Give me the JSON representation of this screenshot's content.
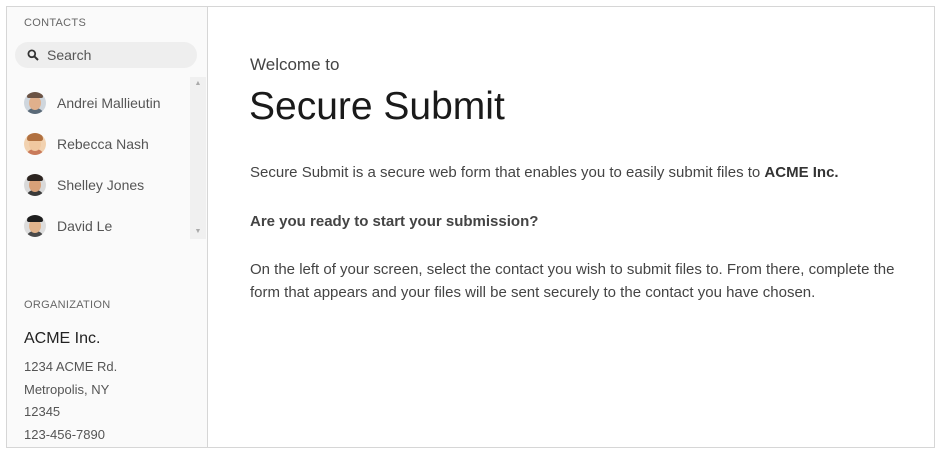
{
  "sidebar": {
    "contacts_title": "CONTACTS",
    "search_placeholder": "Search",
    "contacts": [
      {
        "name": "Andrei Mallieutin",
        "avatar": "person-avatar-1"
      },
      {
        "name": "Rebecca Nash",
        "avatar": "person-avatar-2"
      },
      {
        "name": "Shelley Jones",
        "avatar": "person-avatar-3"
      },
      {
        "name": "David Le",
        "avatar": "person-avatar-4"
      }
    ],
    "organization_title": "ORGANIZATION",
    "organization": {
      "name": "ACME Inc.",
      "address_line1": "1234 ACME Rd.",
      "address_line2": "Metropolis, NY",
      "zip": "12345",
      "phone": "123-456-7890"
    }
  },
  "main": {
    "welcome": "Welcome to",
    "title": "Secure Submit",
    "intro_text": "Secure Submit is a secure web form that enables you to easily submit files to ",
    "intro_company": "ACME Inc.",
    "question": "Are you ready to start your submission?",
    "instructions": "On the left of your screen, select the contact you wish to submit files to. From there, complete the form that appears and your files will be sent securely to the contact you have chosen."
  },
  "icons": {
    "search": "search-icon",
    "scroll_up": "chevron-up-icon",
    "scroll_down": "chevron-down-icon"
  },
  "colors": {
    "sidebar_bg": "#fafafa",
    "search_bg": "#eeeeee",
    "border": "#d6d6d6",
    "text": "#444444"
  }
}
